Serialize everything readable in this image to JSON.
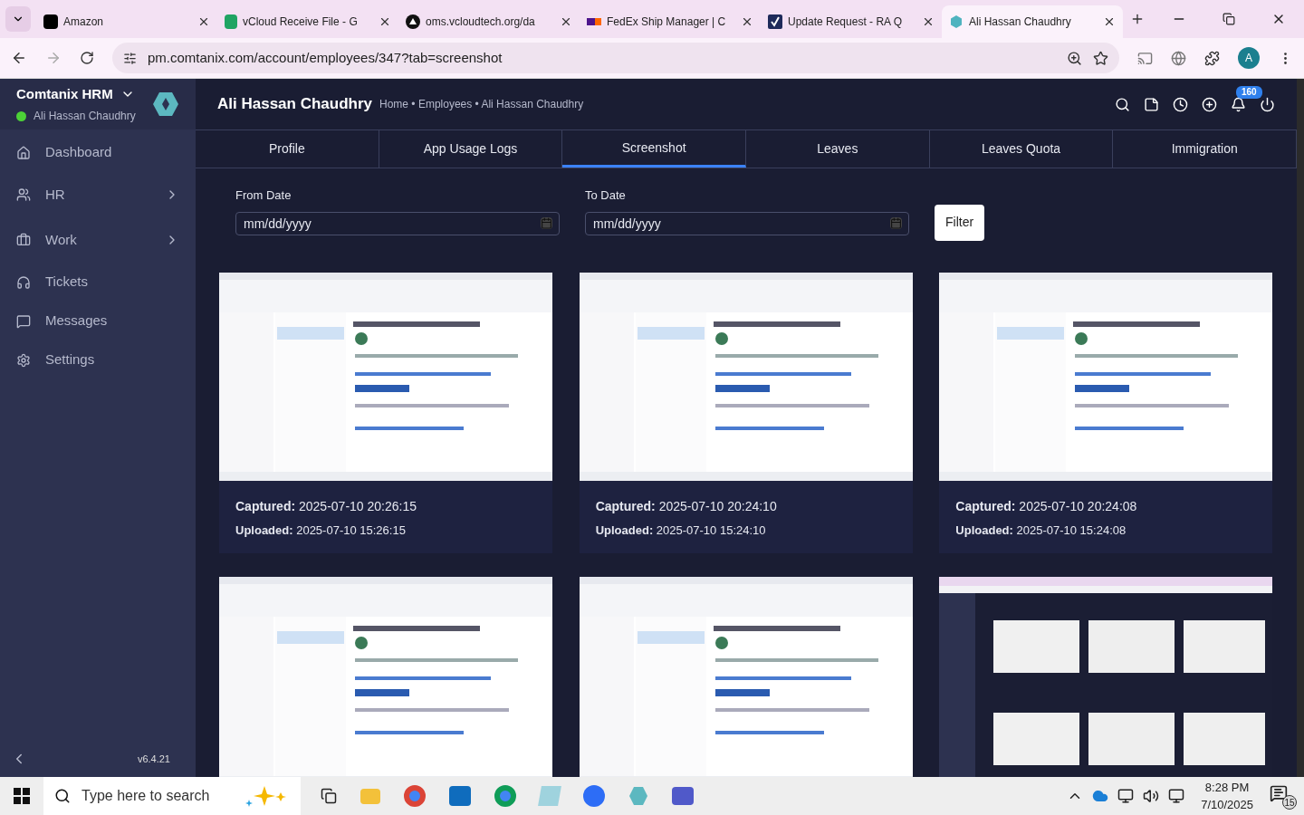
{
  "browser": {
    "tabs": [
      {
        "title": "Amazon",
        "selected": false
      },
      {
        "title": "vCloud Receive File - G",
        "selected": false
      },
      {
        "title": "oms.vcloudtech.org/da",
        "selected": false
      },
      {
        "title": "FedEx Ship Manager | C",
        "selected": false
      },
      {
        "title": "Update Request - RA Q",
        "selected": false
      },
      {
        "title": "Ali Hassan Chaudhry",
        "selected": true
      }
    ],
    "url": "pm.comtanix.com/account/employees/347?tab=screenshot",
    "profile_initial": "A"
  },
  "app": {
    "brand": "Comtanix HRM",
    "user": "Ali Hassan Chaudhry",
    "online": true,
    "sidebar": [
      {
        "label": "Dashboard",
        "has_submenu": false
      },
      {
        "label": "HR",
        "has_submenu": true
      },
      {
        "label": "Work",
        "has_submenu": true
      },
      {
        "label": "Tickets",
        "has_submenu": false
      },
      {
        "label": "Messages",
        "has_submenu": false
      },
      {
        "label": "Settings",
        "has_submenu": false
      }
    ],
    "version": "v6.4.21",
    "page_title": "Ali Hassan Chaudhry",
    "breadcrumb": "Home • Employees • Ali Hassan Chaudhry",
    "notification_count": "160",
    "tabs": [
      {
        "label": "Profile",
        "selected": false
      },
      {
        "label": "App Usage Logs",
        "selected": false
      },
      {
        "label": "Screenshot",
        "selected": true
      },
      {
        "label": "Leaves",
        "selected": false
      },
      {
        "label": "Leaves Quota",
        "selected": false
      },
      {
        "label": "Immigration",
        "selected": false
      }
    ],
    "filters": [
      {
        "label": "From Date",
        "placeholder": "mm/dd/yyyy"
      },
      {
        "label": "To Date",
        "placeholder": "mm/dd/yyyy"
      }
    ],
    "filter_button": "Filter",
    "screenshots": [
      {
        "kind": "email",
        "captured": "**Captured:** 2025-07-10 20:26:15",
        "uploaded": "**Uploaded:** 2025-07-10 15:26:15"
      },
      {
        "kind": "email",
        "captured": "**Captured:** 2025-07-10 20:24:10",
        "uploaded": "**Uploaded:** 2025-07-10 15:24:10"
      },
      {
        "kind": "email",
        "captured": "**Captured:** 2025-07-10 20:24:08",
        "uploaded": "**Uploaded:** 2025-07-10 15:24:08"
      },
      {
        "kind": "email"
      },
      {
        "kind": "email"
      },
      {
        "kind": "dashboard"
      }
    ]
  },
  "taskbar": {
    "search_placeholder": "Type here to search",
    "time": "8:28 PM",
    "date": "7/10/2025",
    "notification_count": "15"
  }
}
